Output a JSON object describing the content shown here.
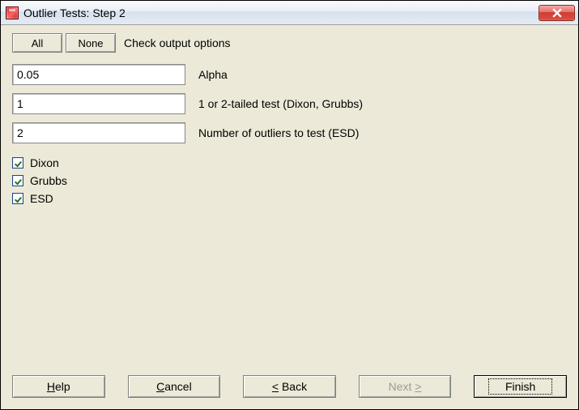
{
  "title": "Outlier Tests: Step 2",
  "toolbar": {
    "all_label": "All",
    "none_label": "None",
    "prompt": "Check output options"
  },
  "fields": {
    "alpha": {
      "value": "0.05",
      "label": "Alpha"
    },
    "tails": {
      "value": "1",
      "label": "1 or 2-tailed test (Dixon, Grubbs)"
    },
    "esd_n": {
      "value": "2",
      "label": "Number of outliers to test (ESD)"
    }
  },
  "checks": {
    "dixon": {
      "label": "Dixon",
      "checked": true
    },
    "grubbs": {
      "label": "Grubbs",
      "checked": true
    },
    "esd": {
      "label": "ESD",
      "checked": true
    }
  },
  "buttons": {
    "help": "Help",
    "cancel": "Cancel",
    "back": "Back",
    "next": "Next",
    "finish": "Finish",
    "next_enabled": false
  }
}
